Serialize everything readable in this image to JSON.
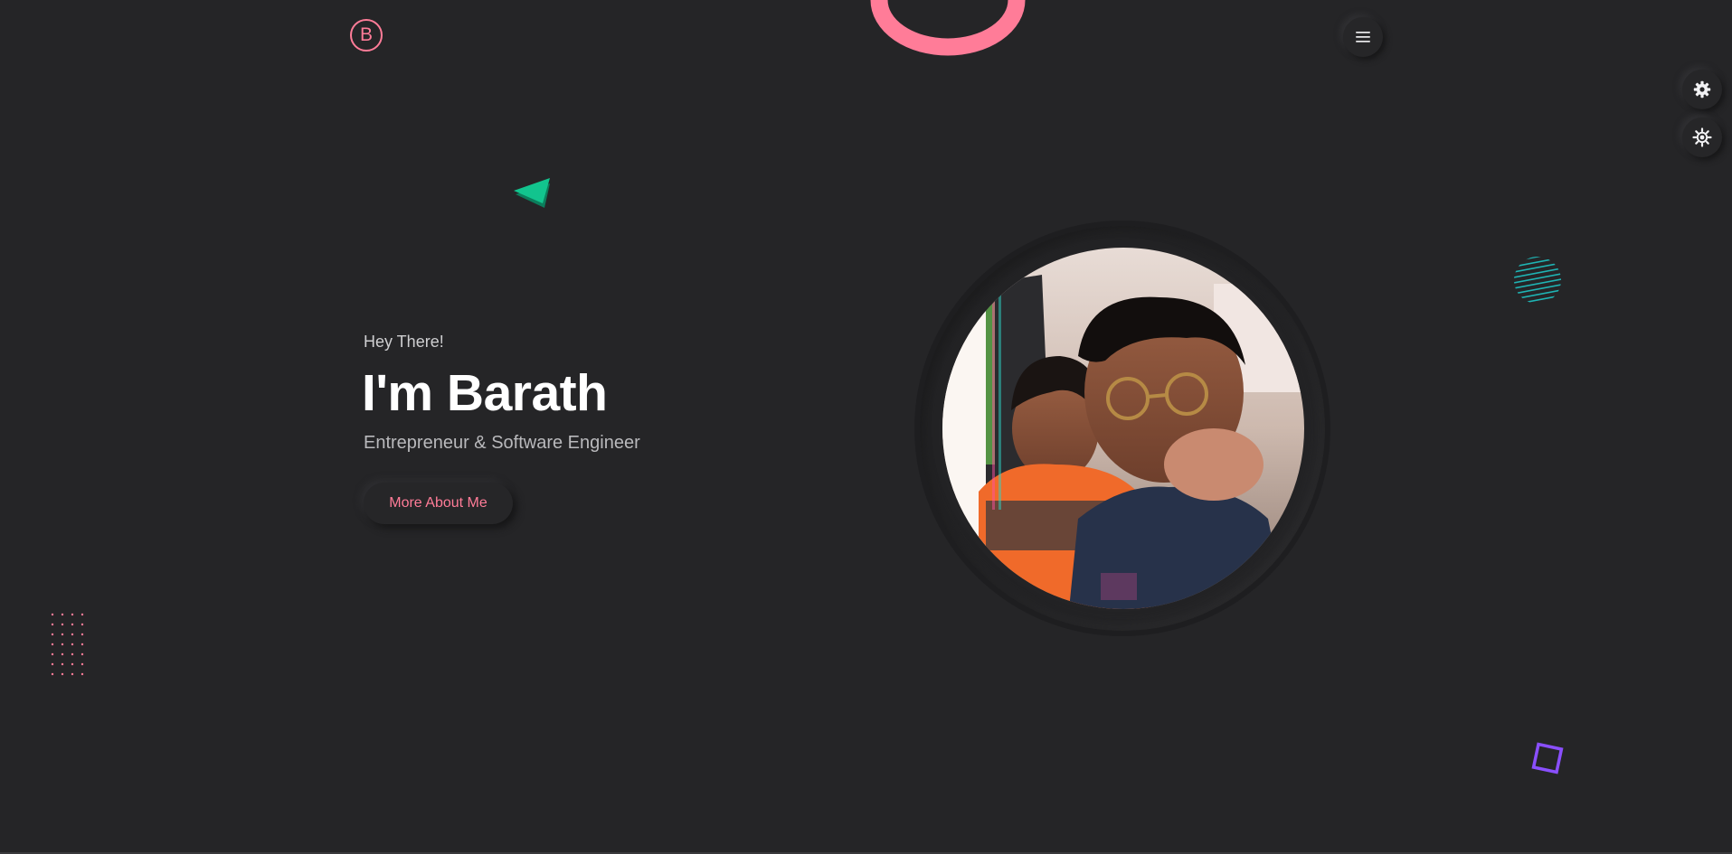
{
  "header": {
    "logo_letter": "B",
    "menu_icon": "hamburger-menu-icon"
  },
  "side_controls": {
    "settings_icon": "gear-icon",
    "theme_icon": "sun-icon"
  },
  "hero": {
    "greeting": "Hey There!",
    "title": "I'm Barath",
    "subtitle": "Entrepreneur & Software Engineer",
    "cta_label": "More About Me"
  },
  "colors": {
    "background": "#252527",
    "accent_pink": "#ff7c98",
    "accent_green": "#11c48c",
    "accent_teal": "#1fb4b4",
    "accent_purple": "#8a4fff",
    "text_primary": "#ffffff",
    "text_secondary": "#b9b9bc"
  }
}
